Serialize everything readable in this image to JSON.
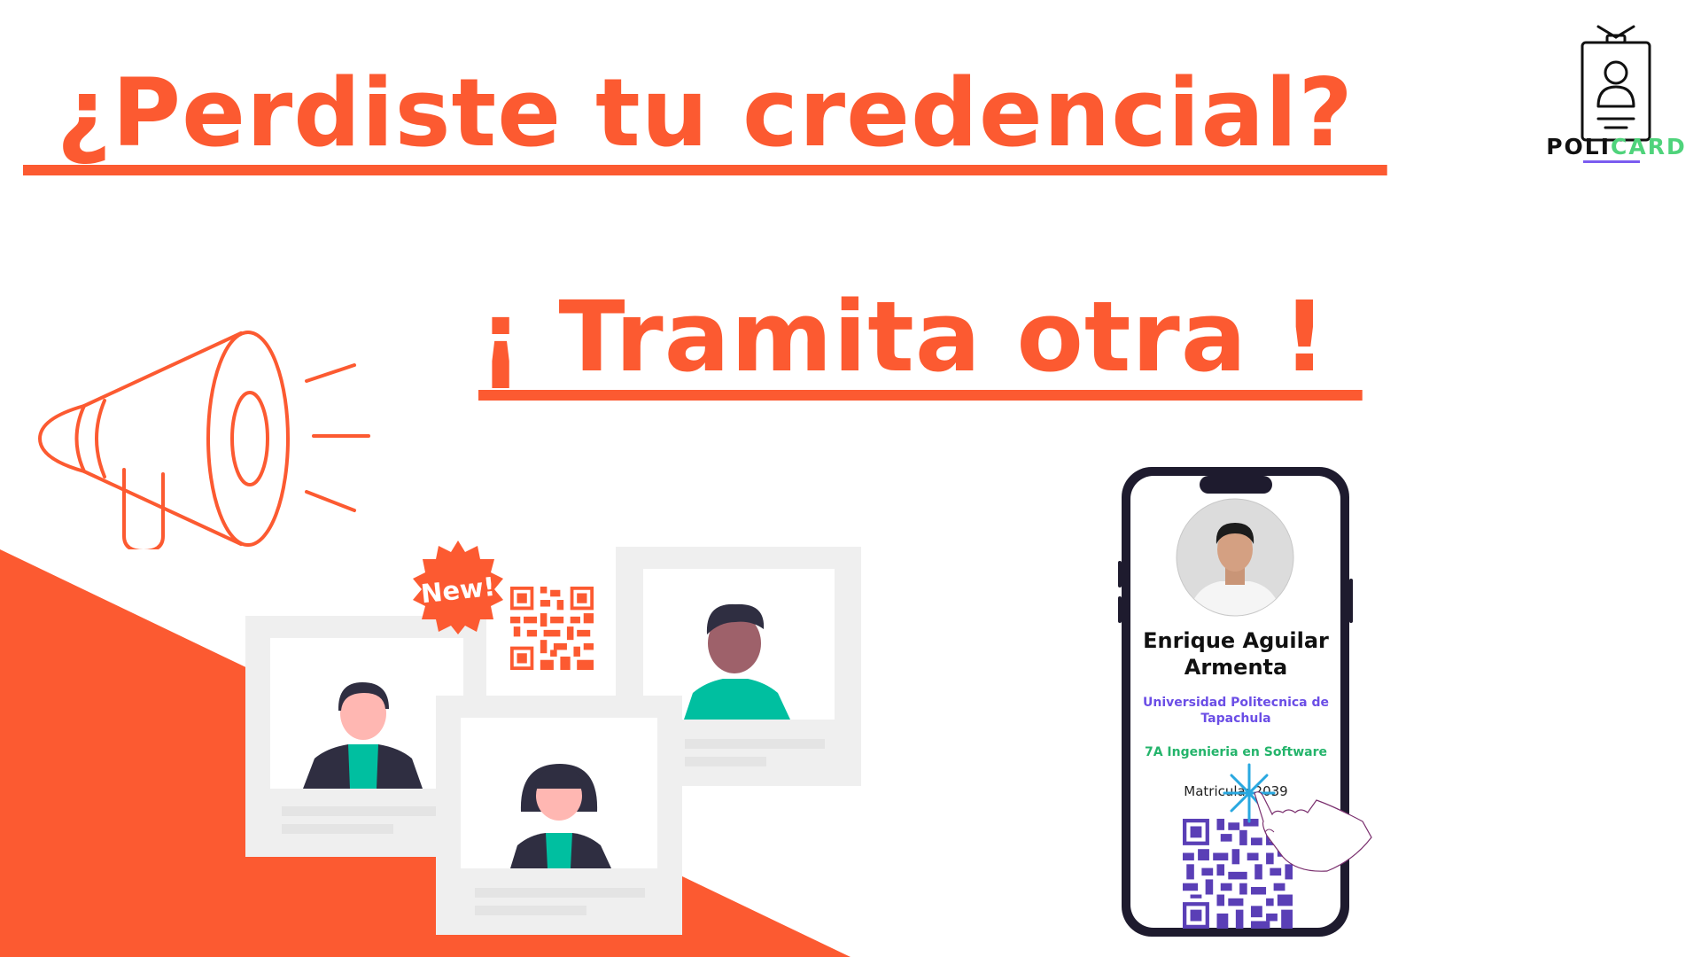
{
  "headline": {
    "line1": " ¿Perdiste tu credencial? ",
    "line2": "¡ Tramita otra ! "
  },
  "brand": {
    "name_part1": "POLI",
    "name_part2": "CARD"
  },
  "badge": {
    "label": "New!"
  },
  "credential": {
    "name": "Enrique Aguilar Armenta",
    "university": "Universidad Politecnica de Tapachula",
    "career": "7A Ingenieria en Software",
    "matricula": "Matricula: 2039"
  },
  "colors": {
    "accent_orange": "#fc5a31",
    "card_grey": "#efefef",
    "teal": "#00bfa0",
    "purple": "#6b4ee6",
    "green": "#24b46b",
    "qr_purple": "#5a3fb6",
    "phone_frame": "#1e1b2e"
  },
  "icons": [
    "megaphone-icon",
    "qr-code-icon",
    "id-card-icon",
    "tap-hand-icon",
    "new-starburst-icon"
  ]
}
